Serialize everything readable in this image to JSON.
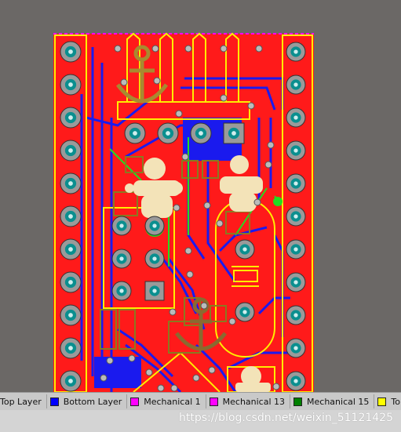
{
  "layers": [
    {
      "label": "Top Layer",
      "color": "#ff0000"
    },
    {
      "label": "Bottom Layer",
      "color": "#0000ff"
    },
    {
      "label": "Mechanical 1",
      "color": "#ff00ff"
    },
    {
      "label": "Mechanical 13",
      "color": "#ff00ff"
    },
    {
      "label": "Mechanical 15",
      "color": "#008000"
    },
    {
      "label": "Top Overlay",
      "color": "#ffff00"
    }
  ],
  "watermark": "https://blog.csdn.net/weixin_51121425",
  "colors": {
    "board": "#ff1a1a",
    "trace_blue": "#1a1aee",
    "silkscreen": "#ffee00",
    "pad_ring": "#9a9a9a",
    "pad_hole": "#0a8f8f",
    "logo": "#f3e3b8",
    "green": "#22dd22"
  }
}
